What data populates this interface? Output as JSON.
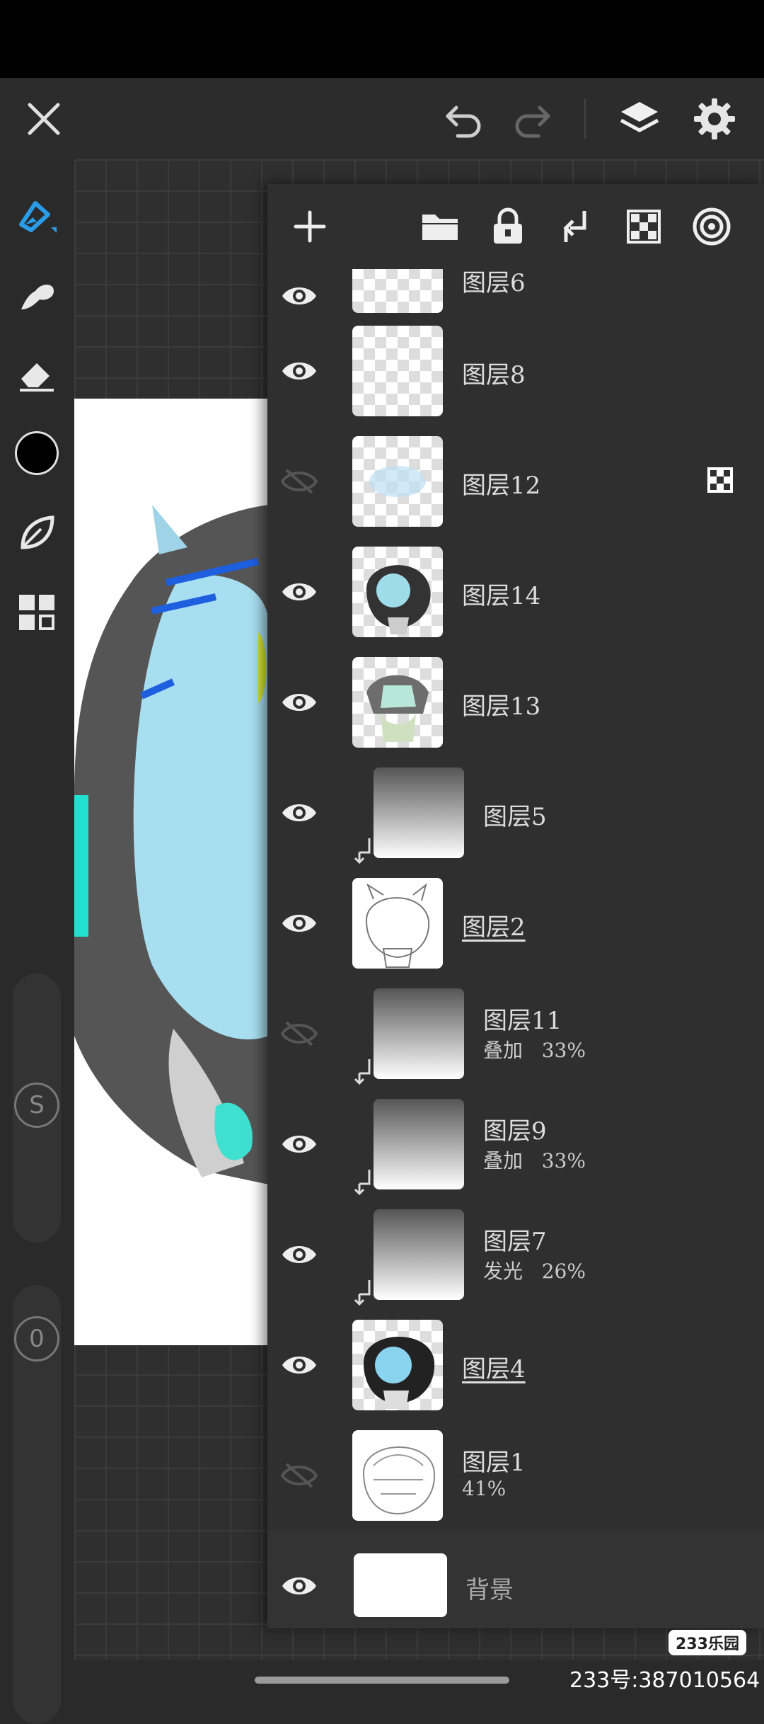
{
  "top_bar": {
    "icons": [
      "close-icon",
      "undo-icon",
      "redo-icon",
      "layers-icon",
      "settings-icon"
    ]
  },
  "left_toolbar": {
    "tools": [
      "brush-tool-icon",
      "smudge-tool-icon",
      "eraser-tool-icon",
      "color-swatch",
      "leaf-tool-icon",
      "grid-tool-icon"
    ],
    "color": "#000000",
    "accent": "#2a9be6",
    "size_slider_label": "S",
    "opacity_slider_label": "0"
  },
  "layer_toolbar": {
    "icons": [
      "add-layer-icon",
      "folder-icon",
      "lock-icon",
      "clip-down-icon",
      "alpha-lock-icon",
      "blend-target-icon"
    ]
  },
  "layers": [
    {
      "name": "图层6",
      "blend": "",
      "opacity": "",
      "visible": true
    },
    {
      "name": "图层8",
      "blend": "",
      "opacity": "",
      "visible": true
    },
    {
      "name": "图层12",
      "blend": "",
      "opacity": "",
      "visible": false,
      "alpha_locked": true
    },
    {
      "name": "图层14",
      "blend": "",
      "opacity": "",
      "visible": true
    },
    {
      "name": "图层13",
      "blend": "",
      "opacity": "",
      "visible": true
    },
    {
      "name": "图层5",
      "blend": "",
      "opacity": "",
      "visible": true,
      "clipped": true
    },
    {
      "name": "图层2",
      "blend": "",
      "opacity": "",
      "visible": true,
      "underlined": true
    },
    {
      "name": "图层11",
      "blend": "叠加",
      "opacity": "33%",
      "visible": false,
      "clipped": true
    },
    {
      "name": "图层9",
      "blend": "叠加",
      "opacity": "33%",
      "visible": true,
      "clipped": true
    },
    {
      "name": "图层7",
      "blend": "发光",
      "opacity": "26%",
      "visible": true,
      "clipped": true
    },
    {
      "name": "图层4",
      "blend": "",
      "opacity": "",
      "visible": true,
      "underlined": true
    },
    {
      "name": "图层1",
      "blend": "",
      "opacity": "41%",
      "visible": false
    },
    {
      "name": "背景",
      "blend": "",
      "opacity": "",
      "visible": true
    }
  ],
  "watermark": {
    "badge": "233乐园",
    "id_text": "233号:387010564"
  }
}
